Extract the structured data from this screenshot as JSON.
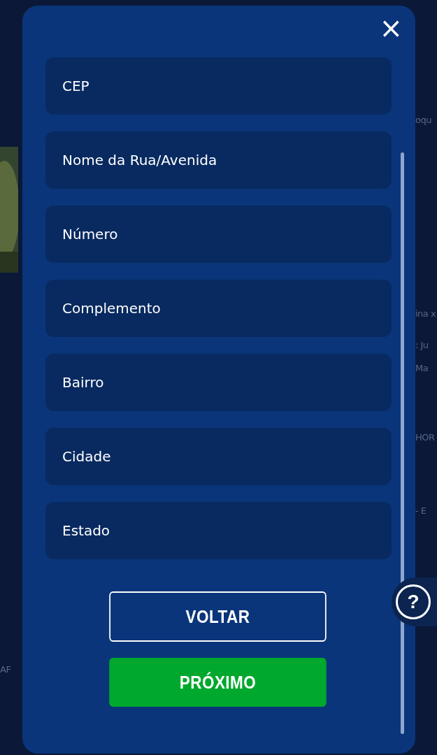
{
  "backdrop": {
    "right_fragments": [
      "oqu",
      "ina x",
      ": Ju",
      "Ma",
      "HOR",
      "- E"
    ],
    "left_fragments": [
      "AF"
    ]
  },
  "dialog": {
    "close": "×",
    "fields": [
      {
        "placeholder": "CEP"
      },
      {
        "placeholder": "Nome da Rua/Avenida"
      },
      {
        "placeholder": "Número"
      },
      {
        "placeholder": "Complemento"
      },
      {
        "placeholder": "Bairro"
      },
      {
        "placeholder": "Cidade"
      },
      {
        "placeholder": "Estado"
      }
    ],
    "buttons": [
      {
        "label": "VOLTAR",
        "kind": "outline"
      },
      {
        "label": "PRÓXIMO",
        "kind": "primary"
      }
    ]
  },
  "help": {
    "label": "?"
  }
}
